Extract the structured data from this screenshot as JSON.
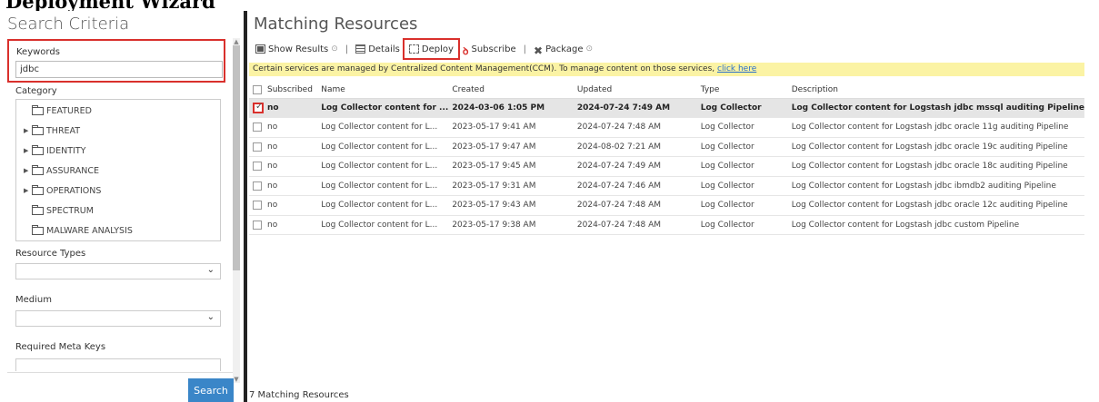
{
  "page_title": "Deployment Wizard",
  "left": {
    "header": "Search Criteria",
    "keywords_label": "Keywords",
    "keywords_value": "jdbc",
    "category_label": "Category",
    "categories": [
      {
        "label": "FEATURED",
        "expandable": false
      },
      {
        "label": "THREAT",
        "expandable": true
      },
      {
        "label": "IDENTITY",
        "expandable": true
      },
      {
        "label": "ASSURANCE",
        "expandable": true
      },
      {
        "label": "OPERATIONS",
        "expandable": true
      },
      {
        "label": "SPECTRUM",
        "expandable": false
      },
      {
        "label": "MALWARE ANALYSIS",
        "expandable": false
      }
    ],
    "resource_types_label": "Resource Types",
    "resource_types_value": "",
    "medium_label": "Medium",
    "medium_value": "",
    "meta_keys_label": "Required Meta Keys",
    "search_button": "Search"
  },
  "right": {
    "header": "Matching Resources",
    "toolbar": {
      "show_results": "Show Results",
      "details": "Details",
      "deploy": "Deploy",
      "subscribe": "Subscribe",
      "package": "Package"
    },
    "notice_text": "Certain services are managed by Centralized Content Management(CCM). To manage content on those services, ",
    "notice_link": "click here",
    "columns": [
      "Subscribed",
      "Name",
      "Created",
      "Updated",
      "Type",
      "Description"
    ],
    "rows": [
      {
        "checked": true,
        "subscribed": "no",
        "name": "Log Collector content for ...",
        "created": "2024-03-06 1:05 PM",
        "updated": "2024-07-24 7:49 AM",
        "type": "Log Collector",
        "description": "Log Collector content for Logstash jdbc mssql auditing Pipeline"
      },
      {
        "checked": false,
        "subscribed": "no",
        "name": "Log Collector content for L...",
        "created": "2023-05-17 9:41 AM",
        "updated": "2024-07-24 7:48 AM",
        "type": "Log Collector",
        "description": "Log Collector content for Logstash jdbc oracle 11g auditing Pipeline"
      },
      {
        "checked": false,
        "subscribed": "no",
        "name": "Log Collector content for L...",
        "created": "2023-05-17 9:47 AM",
        "updated": "2024-08-02 7:21 AM",
        "type": "Log Collector",
        "description": "Log Collector content for Logstash jdbc oracle 19c auditing Pipeline"
      },
      {
        "checked": false,
        "subscribed": "no",
        "name": "Log Collector content for L...",
        "created": "2023-05-17 9:45 AM",
        "updated": "2024-07-24 7:49 AM",
        "type": "Log Collector",
        "description": "Log Collector content for Logstash jdbc oracle 18c auditing Pipeline"
      },
      {
        "checked": false,
        "subscribed": "no",
        "name": "Log Collector content for L...",
        "created": "2023-05-17 9:31 AM",
        "updated": "2024-07-24 7:46 AM",
        "type": "Log Collector",
        "description": "Log Collector content for Logstash jdbc ibmdb2 auditing Pipeline"
      },
      {
        "checked": false,
        "subscribed": "no",
        "name": "Log Collector content for L...",
        "created": "2023-05-17 9:43 AM",
        "updated": "2024-07-24 7:48 AM",
        "type": "Log Collector",
        "description": "Log Collector content for Logstash jdbc oracle 12c auditing Pipeline"
      },
      {
        "checked": false,
        "subscribed": "no",
        "name": "Log Collector content for L...",
        "created": "2023-05-17 9:38 AM",
        "updated": "2024-07-24 7:48 AM",
        "type": "Log Collector",
        "description": "Log Collector content for Logstash jdbc custom Pipeline"
      }
    ],
    "footer": "7 Matching Resources"
  },
  "colors": {
    "highlight": "#d9302c",
    "button": "#3a86c8",
    "notice_bg": "#fbf3a4",
    "link": "#2a6fc9"
  }
}
